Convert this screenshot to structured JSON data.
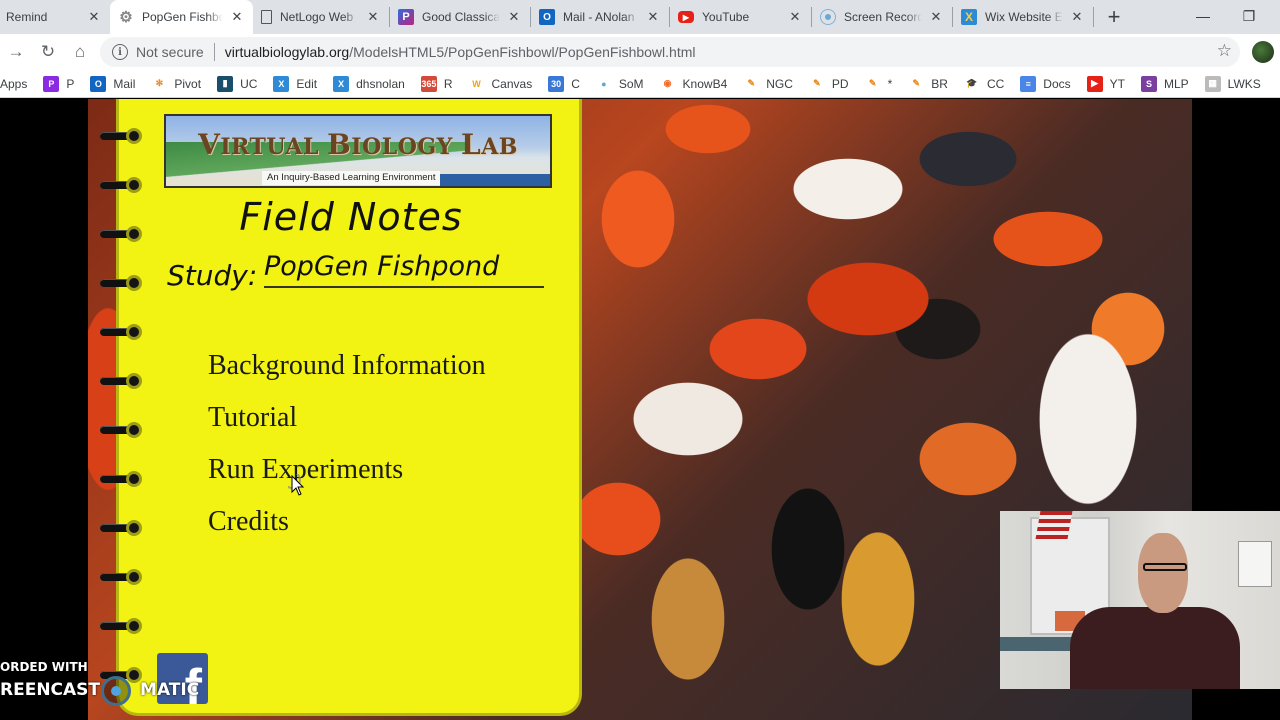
{
  "browser": {
    "tabs": [
      {
        "title": "Remind",
        "icon": "remind-icon",
        "active": false
      },
      {
        "title": "PopGen Fishbowl",
        "icon": "gear-icon",
        "active": true
      },
      {
        "title": "NetLogo Web",
        "icon": "document-icon",
        "active": false
      },
      {
        "title": "Good Classical",
        "icon": "pandora-icon",
        "active": false
      },
      {
        "title": "Mail - ANolan",
        "icon": "outlook-icon",
        "active": false
      },
      {
        "title": "YouTube",
        "icon": "youtube-icon",
        "active": false
      },
      {
        "title": "Screen Recorder",
        "icon": "screencast-icon",
        "active": false
      },
      {
        "title": "Wix Website Editor",
        "icon": "wix-icon",
        "active": false
      }
    ],
    "close_glyph": "✕",
    "new_tab_glyph": "+",
    "window_controls": {
      "minimize": "—",
      "restore": "❐"
    },
    "nav": {
      "forward": "→",
      "reload": "↻",
      "home": "⌂"
    },
    "address": {
      "security_label": "Not secure",
      "host": "virtualbiologylab.org",
      "path": "/ModelsHTML5/PopGenFishbowl/PopGenFishbowl.html"
    },
    "bookmark_star": "☆",
    "bookmarks": [
      {
        "label": "Apps",
        "icon": ""
      },
      {
        "label": "P",
        "icon": "pandora-icon",
        "color": "#8a2be2"
      },
      {
        "label": "Mail",
        "icon": "outlook-icon",
        "color": "#1266c2"
      },
      {
        "label": "Pivot",
        "icon": "pivot-icon",
        "color": "#e88e2b"
      },
      {
        "label": "UC",
        "icon": "uc-icon",
        "color": "#1b4e6b"
      },
      {
        "label": "Edit",
        "icon": "wix-icon",
        "color": "#2c8ad6"
      },
      {
        "label": "dhsnolan",
        "icon": "wix-icon",
        "color": "#2c8ad6"
      },
      {
        "label": "R",
        "icon": "office365-icon",
        "color": "#d44a3a"
      },
      {
        "label": "Canvas",
        "icon": "canvas-icon",
        "color": "#e7a31c"
      },
      {
        "label": "C",
        "icon": "calendar-icon",
        "color": "#3a78d8"
      },
      {
        "label": "SoM",
        "icon": "screencast-icon",
        "color": "#5fa8d3"
      },
      {
        "label": "KnowB4",
        "icon": "knowbe4-icon",
        "color": "#f06a2b"
      },
      {
        "label": "NGC",
        "icon": "pencil-icon",
        "color": "#e8891c"
      },
      {
        "label": "PD",
        "icon": "pencil-icon",
        "color": "#e8891c"
      },
      {
        "label": "*",
        "icon": "pencil-icon",
        "color": "#e8891c"
      },
      {
        "label": "BR",
        "icon": "pencil-icon",
        "color": "#e8891c"
      },
      {
        "label": "CC",
        "icon": "graduation-cap-icon",
        "color": "#222222"
      },
      {
        "label": "Docs",
        "icon": "google-docs-icon",
        "color": "#4a86e8"
      },
      {
        "label": "YT",
        "icon": "youtube-icon",
        "color": "#e62117"
      },
      {
        "label": "MLP",
        "icon": "mlp-icon",
        "color": "#7b3fa0"
      },
      {
        "label": "LWKS",
        "icon": "lwks-icon",
        "color": "#bbbbbb"
      }
    ]
  },
  "page": {
    "banner": {
      "title_parts": [
        "V",
        "IRTUAL ",
        "B",
        "IOLOGY ",
        "L",
        "AB"
      ],
      "subtitle": "An Inquiry-Based Learning Environment"
    },
    "heading": "Field Notes",
    "study_label": "Study:",
    "study_value": "PopGen Fishpond",
    "menu": [
      {
        "label": "Background Information"
      },
      {
        "label": "Tutorial"
      },
      {
        "label": "Run Experiments"
      },
      {
        "label": "Credits"
      }
    ],
    "facebook_glyph": "f",
    "colors": {
      "notebook": "#f2f213",
      "notebook_edge": "#b7b712",
      "banner_text": "#6b4423",
      "facebook": "#3b5998"
    }
  },
  "watermark": {
    "line1": "ORDED WITH",
    "line2_left": "REENCAST",
    "line2_right": "MATIC"
  }
}
